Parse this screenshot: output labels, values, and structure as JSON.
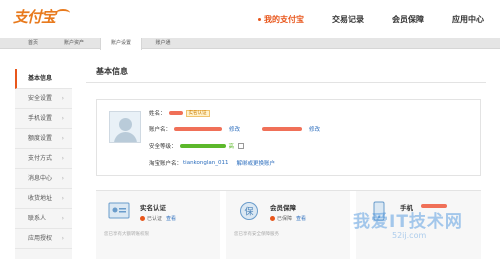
{
  "header": {
    "logo_text": "支付宝",
    "nav": [
      {
        "label": "我的支付宝",
        "active": true
      },
      {
        "label": "交易记录",
        "active": false
      },
      {
        "label": "会员保障",
        "active": false
      },
      {
        "label": "应用中心",
        "active": false
      }
    ]
  },
  "subnav": {
    "items": [
      "首页",
      "账户资产",
      "账户设置",
      "账户通"
    ],
    "active": "账户设置"
  },
  "sidebar": {
    "items": [
      "基本信息",
      "安全设置",
      "手机设置",
      "额度设置",
      "支付方式",
      "消息中心",
      "收货地址",
      "联系人",
      "应用授权"
    ]
  },
  "main": {
    "title": "基本信息",
    "profile": {
      "name_label": "姓名：",
      "badge": "实名认证",
      "account_label": "账户名：",
      "modify": "修改",
      "security_label": "安全等级：",
      "security_level": "高",
      "security_progress": 1.0,
      "taobao_label": "淘宝账户名：",
      "taobao_value": "tiankonglan_011",
      "unbind_link": "解绑或更换账户"
    },
    "cards": [
      {
        "title": "实名认证",
        "status": "已认证",
        "action": "查看",
        "desc": "您已享有大额转账权限"
      },
      {
        "title": "会员保障",
        "status": "已保障",
        "action": "查看",
        "desc": "您已享有安全保障服务"
      },
      {
        "title": "手机",
        "status": "",
        "action": "",
        "desc": ""
      }
    ]
  },
  "watermark": {
    "text": "我爱IT技术网",
    "url": "52ij.com"
  },
  "colors": {
    "brand": "#e8561b",
    "link": "#2b6dbd",
    "success": "#5cb82b"
  }
}
